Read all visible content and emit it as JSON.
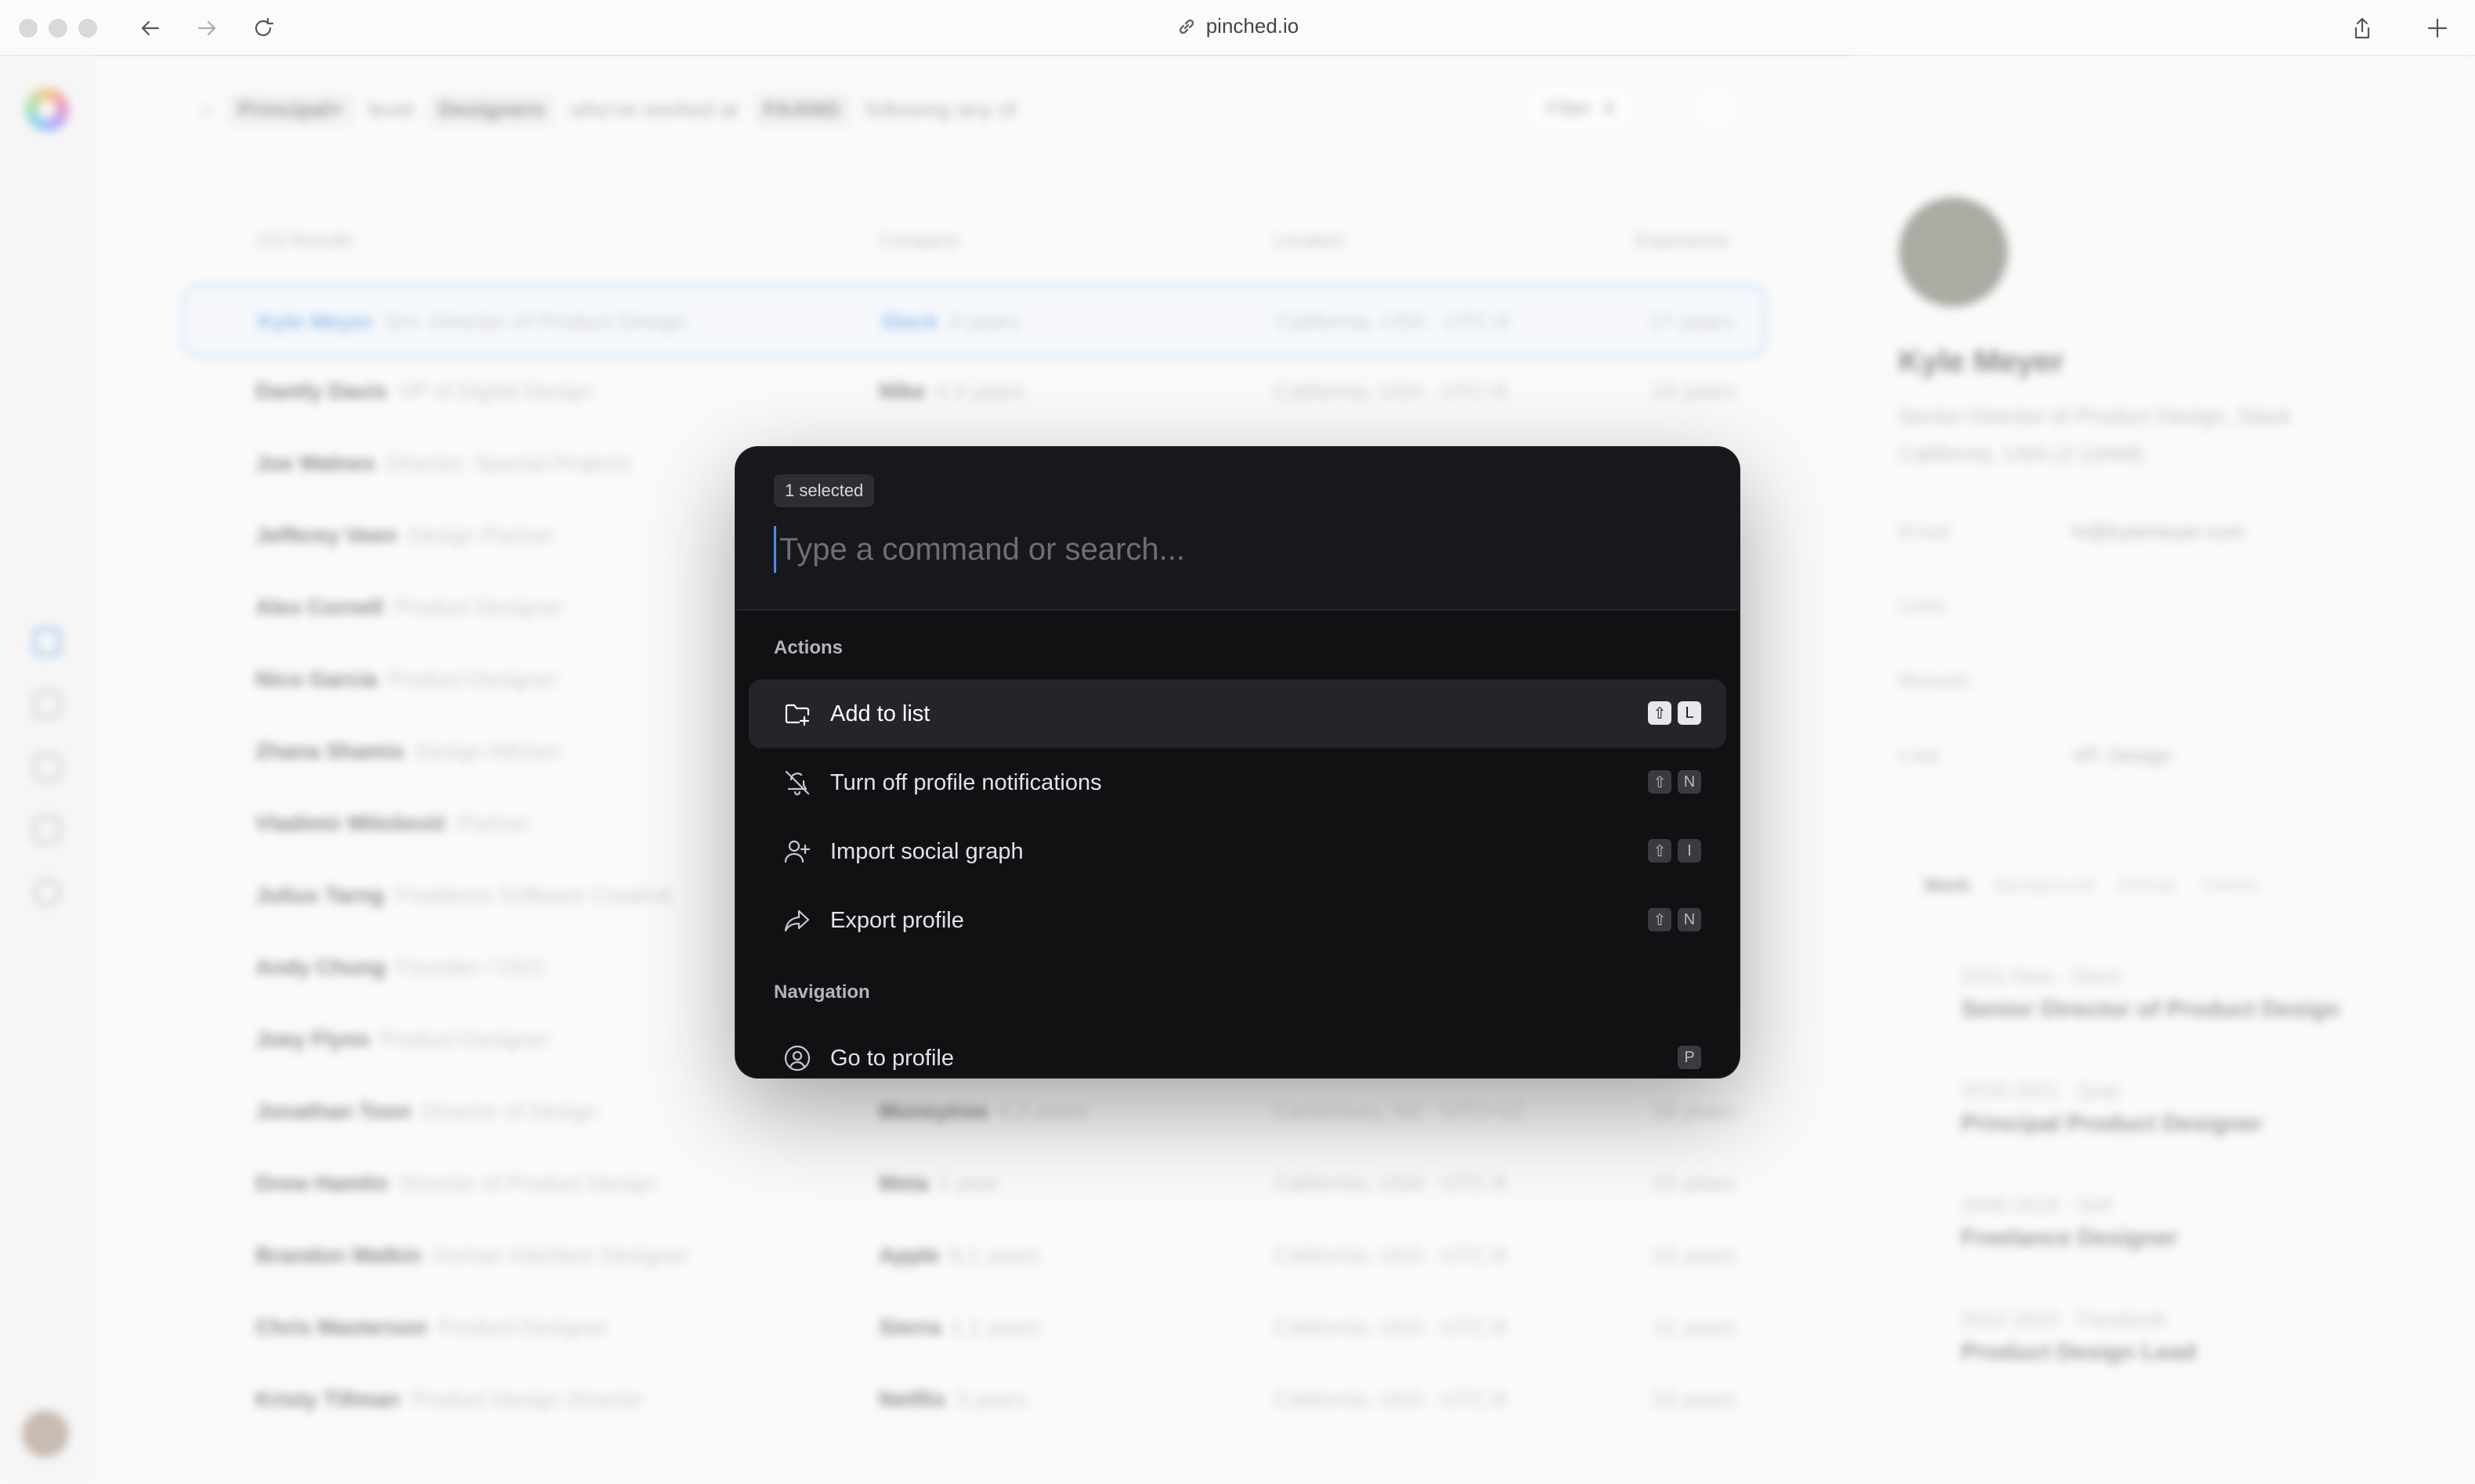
{
  "browser": {
    "url": "pinched.io"
  },
  "filters": {
    "chips": [
      "Principal+",
      "level",
      "Designers",
      "who've worked at",
      "FAANG",
      "following any of"
    ],
    "filter_label": "Filter",
    "filter_count": "4"
  },
  "table": {
    "results_label": "113 Results",
    "col_company": "Company",
    "col_location": "Location",
    "col_experience": "Experience",
    "rows": [
      {
        "name": "Kyle Meyer",
        "title": "Snr. Director of Product Design",
        "company": "Slack",
        "tenure": "3 years",
        "location": "California, USA · UTC-8",
        "exp": "17 years"
      },
      {
        "name": "Dantly Davis",
        "title": "VP of Digital Design",
        "company": "Nike",
        "tenure": "4.3 years",
        "location": "California, USA · UTC-8",
        "exp": "18 years"
      },
      {
        "name": "Joe Walnes",
        "title": "Director, Special Projects",
        "company": "",
        "tenure": "",
        "location": "",
        "exp": ""
      },
      {
        "name": "Jefferey Veen",
        "title": "Design Partner",
        "company": "",
        "tenure": "",
        "location": "",
        "exp": ""
      },
      {
        "name": "Alex Cornell",
        "title": "Product Designer",
        "company": "",
        "tenure": "",
        "location": "",
        "exp": ""
      },
      {
        "name": "Nico Garcia",
        "title": "Product Designer",
        "company": "",
        "tenure": "",
        "location": "",
        "exp": ""
      },
      {
        "name": "Zhana Shamis",
        "title": "Design Advisor",
        "company": "",
        "tenure": "",
        "location": "",
        "exp": ""
      },
      {
        "name": "Vladimir Milošević",
        "title": "Partner",
        "company": "",
        "tenure": "",
        "location": "",
        "exp": ""
      },
      {
        "name": "Julius Tarng",
        "title": "Freelance Software Creative",
        "company": "",
        "tenure": "",
        "location": "",
        "exp": ""
      },
      {
        "name": "Andy Chung",
        "title": "Founder / CEO",
        "company": "",
        "tenure": "",
        "location": "",
        "exp": ""
      },
      {
        "name": "Joey Flynn",
        "title": "Product Designer",
        "company": "",
        "tenure": "",
        "location": "",
        "exp": ""
      },
      {
        "name": "Jonathan Toon",
        "title": "Director of Design",
        "company": "Moneytree",
        "tenure": "4.2 years",
        "location": "Canterbury, NZ · UTC+12",
        "exp": "18 years"
      },
      {
        "name": "Drew Hamlin",
        "title": "Director of Product Design",
        "company": "Meta",
        "tenure": "1 year",
        "location": "California, USA · UTC-8",
        "exp": "15 years"
      },
      {
        "name": "Brandon Walkin",
        "title": "Human Interface Designer",
        "company": "Apple",
        "tenure": "8.1 years",
        "location": "California, USA · UTC-8",
        "exp": "15 years"
      },
      {
        "name": "Chris Masterson",
        "title": "Product Designer",
        "company": "Sierra",
        "tenure": "1.1 years",
        "location": "California, USA · UTC-8",
        "exp": "11 years"
      },
      {
        "name": "Kristy Tillman",
        "title": "Product Design Director",
        "company": "Netflix",
        "tenure": "3 years",
        "location": "California, USA · UTC-8",
        "exp": "23 years"
      }
    ]
  },
  "profile": {
    "name": "Kyle Meyer",
    "subtitle_1": "Senior Director of Product Design, Slack",
    "subtitle_2": "California, USA (2:13AM)",
    "email_label": "Email",
    "email": "hi@kylemeyer.com",
    "links_label": "Links",
    "mutuals_label": "Mutuals",
    "lists_label": "Lists",
    "list_value": "VP, Design",
    "tabs": [
      "Work",
      "Background",
      "GitHub",
      "Tweets"
    ],
    "timeline": [
      {
        "period": "2021-Now · Slack",
        "role": "Senior Director of Product Design"
      },
      {
        "period": "2019-2021 · Quip",
        "role": "Principal Product Designer"
      },
      {
        "period": "2006-2019 · Self",
        "role": "Freelance Designer"
      },
      {
        "period": "2012-2015 · Facebook",
        "role": "Product Design Lead"
      }
    ]
  },
  "palette": {
    "badge": "1 selected",
    "placeholder": "Type a command or search...",
    "section_actions": "Actions",
    "section_navigation": "Navigation",
    "items": [
      {
        "label": "Add to list",
        "icon": "folder-plus-icon",
        "keys": [
          "⇧",
          "L"
        ]
      },
      {
        "label": "Turn off profile notifications",
        "icon": "bell-off-icon",
        "keys": [
          "⇧",
          "N"
        ]
      },
      {
        "label": "Import social graph",
        "icon": "user-plus-icon",
        "keys": [
          "⇧",
          "I"
        ]
      },
      {
        "label": "Export profile",
        "icon": "share-arrow-icon",
        "keys": [
          "⇧",
          "N"
        ]
      },
      {
        "label": "Go to profile",
        "icon": "user-circle-icon",
        "keys": [
          "P"
        ]
      }
    ]
  }
}
